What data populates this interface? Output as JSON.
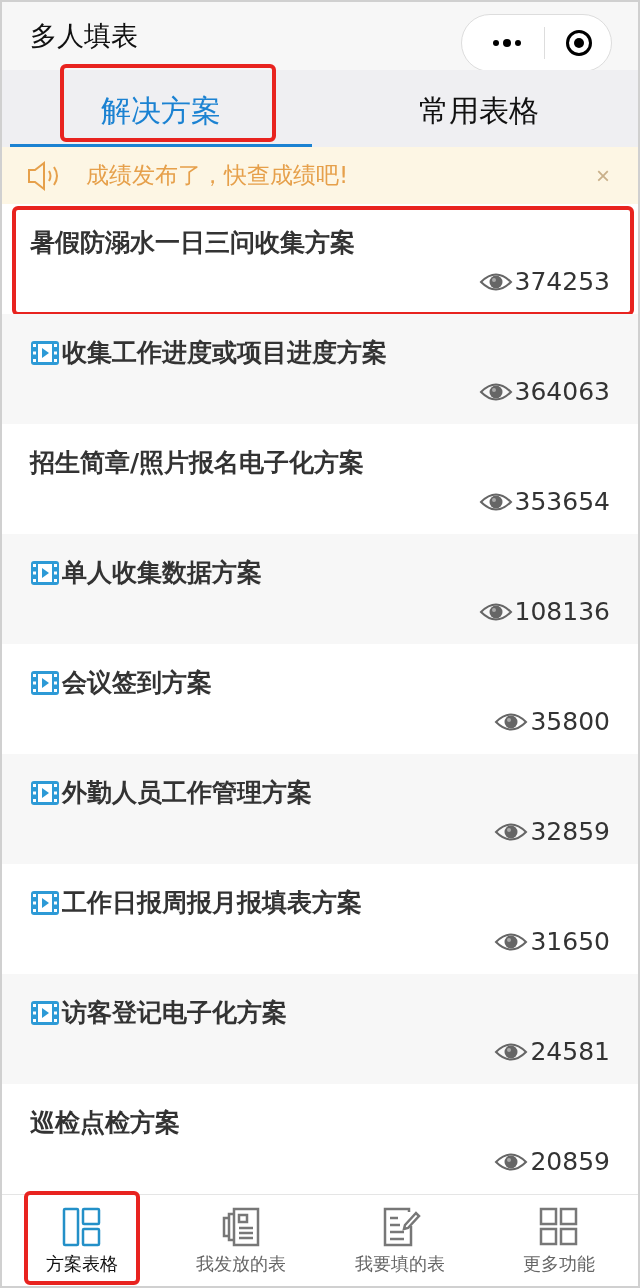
{
  "header": {
    "title": "多人填表"
  },
  "tabs": [
    {
      "label": "解决方案",
      "selected": true,
      "highlighted": true
    },
    {
      "label": "常用表格",
      "selected": false,
      "highlighted": false
    }
  ],
  "notice": {
    "text": "成绩发布了，快查成绩吧!",
    "close": "×"
  },
  "items": [
    {
      "title": "暑假防溺水一日三问收集方案",
      "video": false,
      "views": "374253",
      "highlighted": true
    },
    {
      "title": "收集工作进度或项目进度方案",
      "video": true,
      "views": "364063",
      "highlighted": false
    },
    {
      "title": "招生简章/照片报名电子化方案",
      "video": false,
      "views": "353654",
      "highlighted": false
    },
    {
      "title": "单人收集数据方案",
      "video": true,
      "views": "108136",
      "highlighted": false
    },
    {
      "title": "会议签到方案",
      "video": true,
      "views": "35800",
      "highlighted": false
    },
    {
      "title": "外勤人员工作管理方案",
      "video": true,
      "views": "32859",
      "highlighted": false
    },
    {
      "title": "工作日报周报月报填表方案",
      "video": true,
      "views": "31650",
      "highlighted": false
    },
    {
      "title": "访客登记电子化方案",
      "video": true,
      "views": "24581",
      "highlighted": false
    },
    {
      "title": "巡检点检方案",
      "video": false,
      "views": "20859",
      "highlighted": false
    }
  ],
  "nav": [
    {
      "kind": "panels",
      "label": "方案表格",
      "selected": true,
      "highlighted": true
    },
    {
      "kind": "document",
      "label": "我发放的表",
      "selected": false,
      "highlighted": false
    },
    {
      "kind": "edit",
      "label": "我要填的表",
      "selected": false,
      "highlighted": false
    },
    {
      "kind": "grid",
      "label": "更多功能",
      "selected": false,
      "highlighted": false
    }
  ]
}
